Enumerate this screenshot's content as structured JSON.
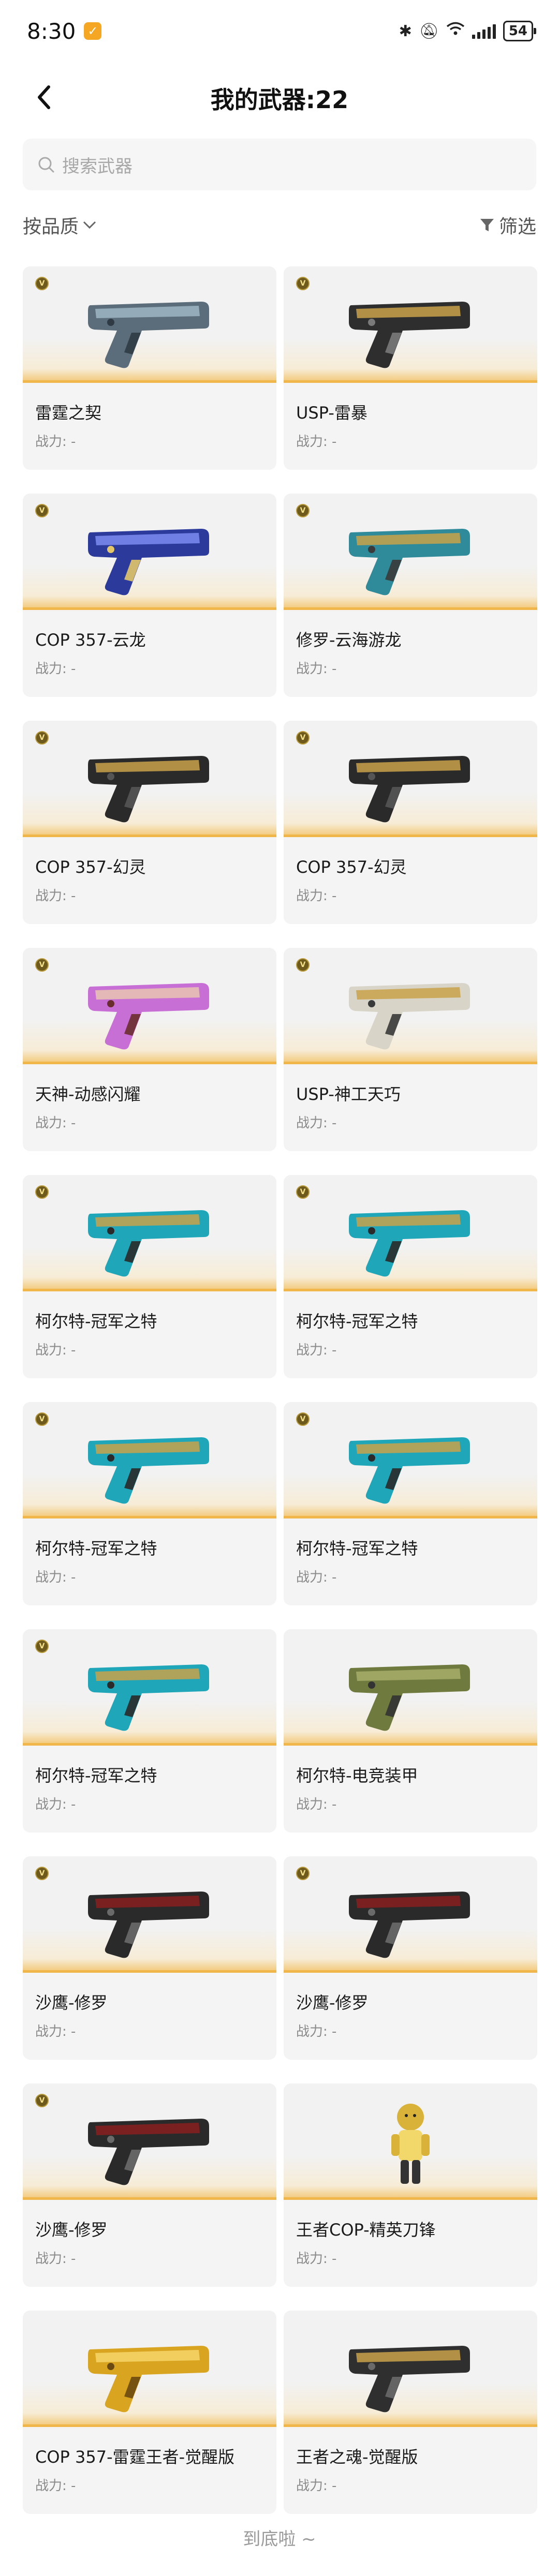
{
  "status_bar": {
    "time": "8:30",
    "battery": "54"
  },
  "header": {
    "title": "我的武器:22"
  },
  "search": {
    "placeholder": "搜索武器"
  },
  "filters": {
    "sort_label": "按品质",
    "filter_label": "筛选"
  },
  "power_label": "战力: -",
  "badge_letter": "V",
  "weapons": [
    {
      "name": "雷霆之契",
      "badge": true,
      "palette": [
        "#5b6d7a",
        "#9fb7c6",
        "#2f3a44"
      ]
    },
    {
      "name": "USP-雷暴",
      "badge": true,
      "palette": [
        "#2e2e2e",
        "#c9a24a",
        "#7a7a7a"
      ]
    },
    {
      "name": "COP 357-云龙",
      "badge": true,
      "palette": [
        "#2c3a9c",
        "#7d8cf0",
        "#e3c66a"
      ]
    },
    {
      "name": "修罗-云海游龙",
      "badge": true,
      "palette": [
        "#2f8a9a",
        "#c9a24a",
        "#3a3a3a"
      ]
    },
    {
      "name": "COP 357-幻灵",
      "badge": true,
      "palette": [
        "#2a2a2a",
        "#c9a24a",
        "#555555"
      ]
    },
    {
      "name": "COP 357-幻灵",
      "badge": true,
      "palette": [
        "#2a2a2a",
        "#c9a24a",
        "#555555"
      ]
    },
    {
      "name": "天神-动感闪耀",
      "badge": true,
      "palette": [
        "#c86fd6",
        "#e7c6b0",
        "#6a2d2d"
      ]
    },
    {
      "name": "USP-神工天巧",
      "badge": true,
      "palette": [
        "#d8d4c8",
        "#c9a24a",
        "#3a3a3a"
      ]
    },
    {
      "name": "柯尔特-冠军之特",
      "badge": true,
      "palette": [
        "#1fa6b8",
        "#c9a24a",
        "#2a2a2a"
      ]
    },
    {
      "name": "柯尔特-冠军之特",
      "badge": true,
      "palette": [
        "#1fa6b8",
        "#c9a24a",
        "#2a2a2a"
      ]
    },
    {
      "name": "柯尔特-冠军之特",
      "badge": true,
      "palette": [
        "#1fa6b8",
        "#c9a24a",
        "#2a2a2a"
      ]
    },
    {
      "name": "柯尔特-冠军之特",
      "badge": true,
      "palette": [
        "#1fa6b8",
        "#c9a24a",
        "#2a2a2a"
      ]
    },
    {
      "name": "柯尔特-冠军之特",
      "badge": true,
      "palette": [
        "#1fa6b8",
        "#c9a24a",
        "#2a2a2a"
      ]
    },
    {
      "name": "柯尔特-电竞装甲",
      "badge": false,
      "palette": [
        "#6f7a3e",
        "#a8ad6a",
        "#333333"
      ]
    },
    {
      "name": "沙鹰-修罗",
      "badge": true,
      "palette": [
        "#2a2a2a",
        "#8a1f1f",
        "#6a6a6a"
      ]
    },
    {
      "name": "沙鹰-修罗",
      "badge": true,
      "palette": [
        "#2a2a2a",
        "#8a1f1f",
        "#6a6a6a"
      ]
    },
    {
      "name": "沙鹰-修罗",
      "badge": true,
      "palette": [
        "#2a2a2a",
        "#8a1f1f",
        "#6a6a6a"
      ]
    },
    {
      "name": "王者COP-精英刀锋",
      "badge": false,
      "palette": [
        "#d9b23a",
        "#f2d86a",
        "#333333"
      ],
      "figure": true
    },
    {
      "name": "COP 357-雷霆王者-觉醒版",
      "badge": false,
      "palette": [
        "#d9a520",
        "#f5d56a",
        "#6a4a10"
      ]
    },
    {
      "name": "王者之魂-觉醒版",
      "badge": false,
      "palette": [
        "#2f2f2f",
        "#c9a24a",
        "#6a6a6a"
      ]
    }
  ],
  "footer": {
    "end_text": "到底啦 ~"
  }
}
